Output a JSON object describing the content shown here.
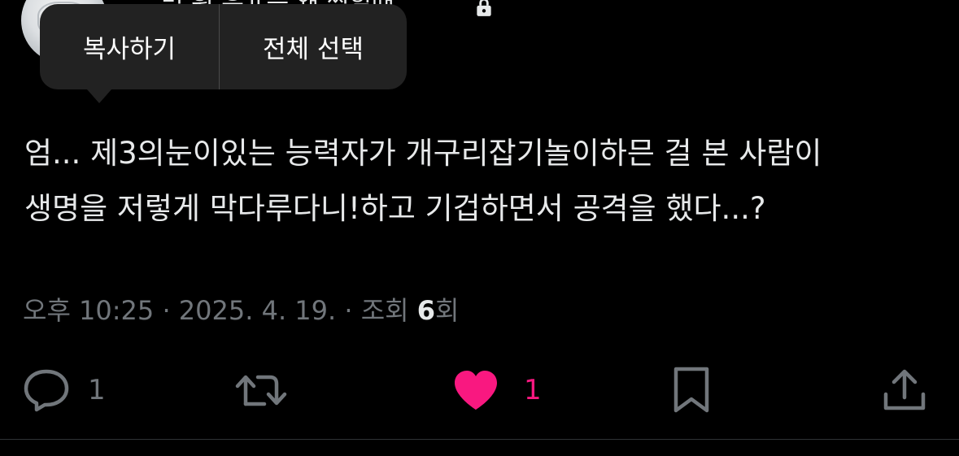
{
  "header": {
    "username_visible": "…밍 훤 유ㅍ는 왜 찍힐때",
    "lock_icon": "lock-icon"
  },
  "context_menu": {
    "copy_label": "복사하기",
    "select_all_label": "전체 선택"
  },
  "tweet": {
    "text": "엄... 제3의눈이있는 능력자가 개구리잡기놀이하믄 걸 본 사람이\n생명을 저렇게 막다루다니!하고 기겁하면서 공격을 했다...?"
  },
  "meta": {
    "time": "오후 10:25",
    "sep1": " · ",
    "date": "2025. 4. 19.",
    "sep2": " · ",
    "views_label": "조회 ",
    "views_count": "6",
    "views_suffix": "회"
  },
  "actions": {
    "reply_count": "1",
    "retweet_count": "",
    "like_count": "1",
    "liked": true
  },
  "colors": {
    "background": "#000000",
    "text": "#e7e9ea",
    "muted": "#71767b",
    "like": "#f91880",
    "menu_bg": "#222222"
  }
}
